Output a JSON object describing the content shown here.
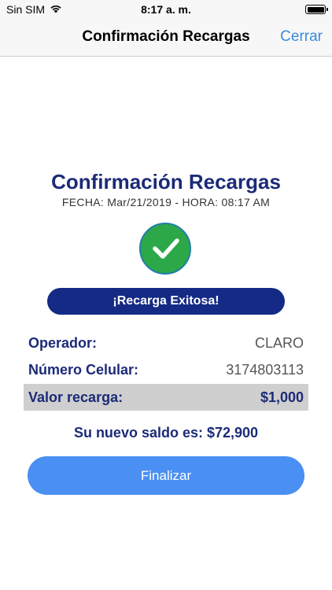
{
  "status_bar": {
    "carrier": "Sin SIM",
    "time": "8:17 a. m."
  },
  "nav": {
    "title": "Confirmación Recargas",
    "close_label": "Cerrar"
  },
  "confirmation": {
    "title": "Confirmación Recargas",
    "date_line": "FECHA: Mar/21/2019 - HORA: 08:17 AM",
    "status_icon": "checkmark-icon",
    "banner": "¡Recarga Exitosa!"
  },
  "details": {
    "operator_label": "Operador:",
    "operator_value": "CLARO",
    "number_label": "Número Celular:",
    "number_value": "3174803113",
    "amount_label": "Valor recarga:",
    "amount_value": "$1,000"
  },
  "balance_text": "Su nuevo saldo es: $72,900",
  "finish_label": "Finalizar",
  "colors": {
    "brand_navy": "#1c2a78",
    "banner_navy": "#142a84",
    "success_green": "#2da849",
    "button_blue": "#4a8ff2",
    "link_blue": "#3a8bdb"
  }
}
